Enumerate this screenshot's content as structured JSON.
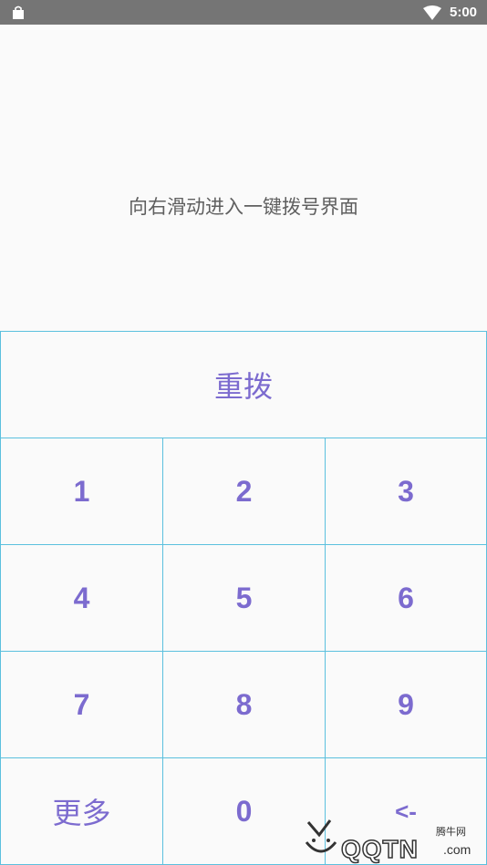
{
  "status_bar": {
    "time": "5:00",
    "left_icon": "shopping-bag-icon",
    "right_icon": "wifi-icon"
  },
  "hint": {
    "text": "向右滑动进入一键拨号界面"
  },
  "keypad": {
    "redial_label": "重拨",
    "keys": [
      "1",
      "2",
      "3",
      "4",
      "5",
      "6",
      "7",
      "8",
      "9"
    ],
    "more_label": "更多",
    "zero_label": "0",
    "backspace_label": "<-"
  },
  "watermark": {
    "top_text": "腾牛网",
    "main_text": "QQTN",
    "suffix_text": ".com"
  },
  "colors": {
    "status_bar": "#757575",
    "key_text": "#7c6bcf",
    "key_border": "#5bc0de",
    "background": "#fafafa",
    "hint_text": "#5f5f5f"
  }
}
